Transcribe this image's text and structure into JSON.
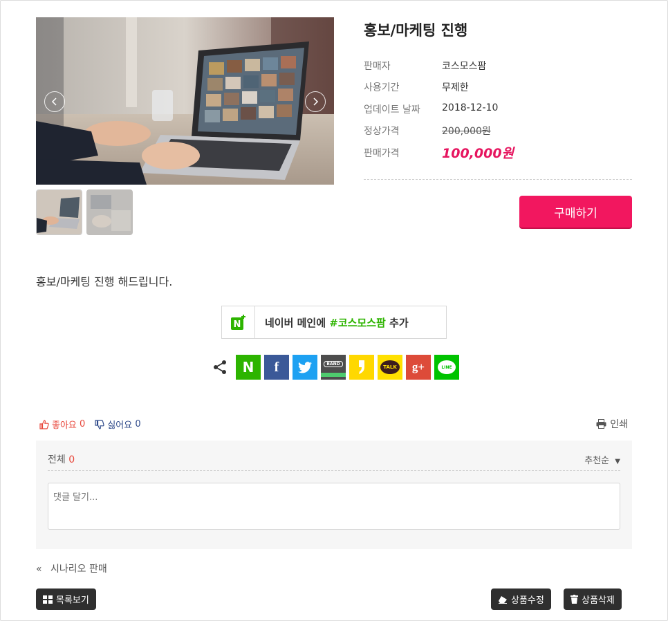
{
  "product": {
    "title": "홍보/마케팅 진행",
    "info": [
      {
        "label": "판매자",
        "value": "코스모스팜"
      },
      {
        "label": "사용기간",
        "value": "무제한"
      },
      {
        "label": "업데이트 날짜",
        "value": "2018-12-10"
      },
      {
        "label": "정상가격",
        "value": "200,000원"
      },
      {
        "label": "판매가격",
        "value": "100,000원"
      }
    ],
    "buy_label": "구매하기",
    "description": "홍보/마케팅 진행 해드립니다."
  },
  "naver": {
    "text_prefix": "네이버 메인에 ",
    "hashtag": "#코스모스팜",
    "text_suffix": " 추가"
  },
  "share": {
    "icons": [
      {
        "name": "naver-icon",
        "color": "#2db400",
        "glyph": "N"
      },
      {
        "name": "facebook-icon",
        "color": "#3b5998",
        "glyph": "f"
      },
      {
        "name": "twitter-icon",
        "color": "#1da1f2",
        "glyph": "t"
      },
      {
        "name": "band-icon",
        "color": "#4d4d4d",
        "glyph": "BAND"
      },
      {
        "name": "kakaostory-icon",
        "color": "#ffd800",
        "glyph": "s"
      },
      {
        "name": "kakaotalk-icon",
        "color": "#ffe000",
        "glyph": "TALK"
      },
      {
        "name": "googleplus-icon",
        "color": "#dd4b39",
        "glyph": "g+"
      },
      {
        "name": "line-icon",
        "color": "#00c300",
        "glyph": "LINE"
      }
    ]
  },
  "reactions": {
    "like_label": "좋아요",
    "like_count": "0",
    "dislike_label": "싫어요",
    "dislike_count": "0",
    "print_label": "인쇄"
  },
  "comments": {
    "total_label": "전체",
    "total_count": "0",
    "sort_label": "추천순",
    "placeholder": "댓글 달기..."
  },
  "nav": {
    "prev_label": "시나리오 판매",
    "list_label": "목록보기",
    "edit_label": "상품수정",
    "delete_label": "상품삭제"
  },
  "colors": {
    "accent": "#f2175f",
    "sale_price": "#e6155f",
    "like": "#e8473b",
    "dislike": "#2f4a8a"
  }
}
